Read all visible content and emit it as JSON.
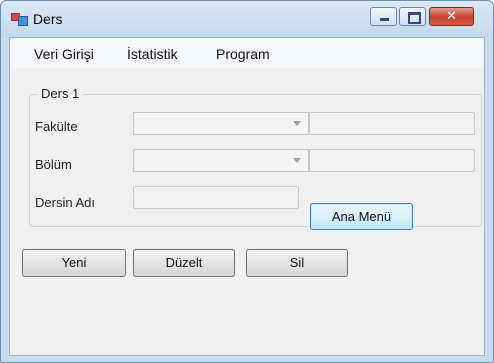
{
  "window": {
    "title": "Ders",
    "icon": "form-app-icon",
    "close_glyph": "✕"
  },
  "menu": {
    "items": [
      "Veri Girişi",
      "İstatistik",
      "Program"
    ]
  },
  "group": {
    "title": "Ders 1",
    "fakulte_label": "Fakülte",
    "bolum_label": "Bölüm",
    "ders_adi_label": "Dersin Adı",
    "fakulte_value": "",
    "bolum_value": "",
    "ders_adi_value": "",
    "fakulte_text": "",
    "bolum_text": "",
    "ana_menu_label": "Ana Menü"
  },
  "actions": {
    "yeni_label": "Yeni",
    "duzelt_label": "Düzelt",
    "sil_label": "Sil"
  }
}
